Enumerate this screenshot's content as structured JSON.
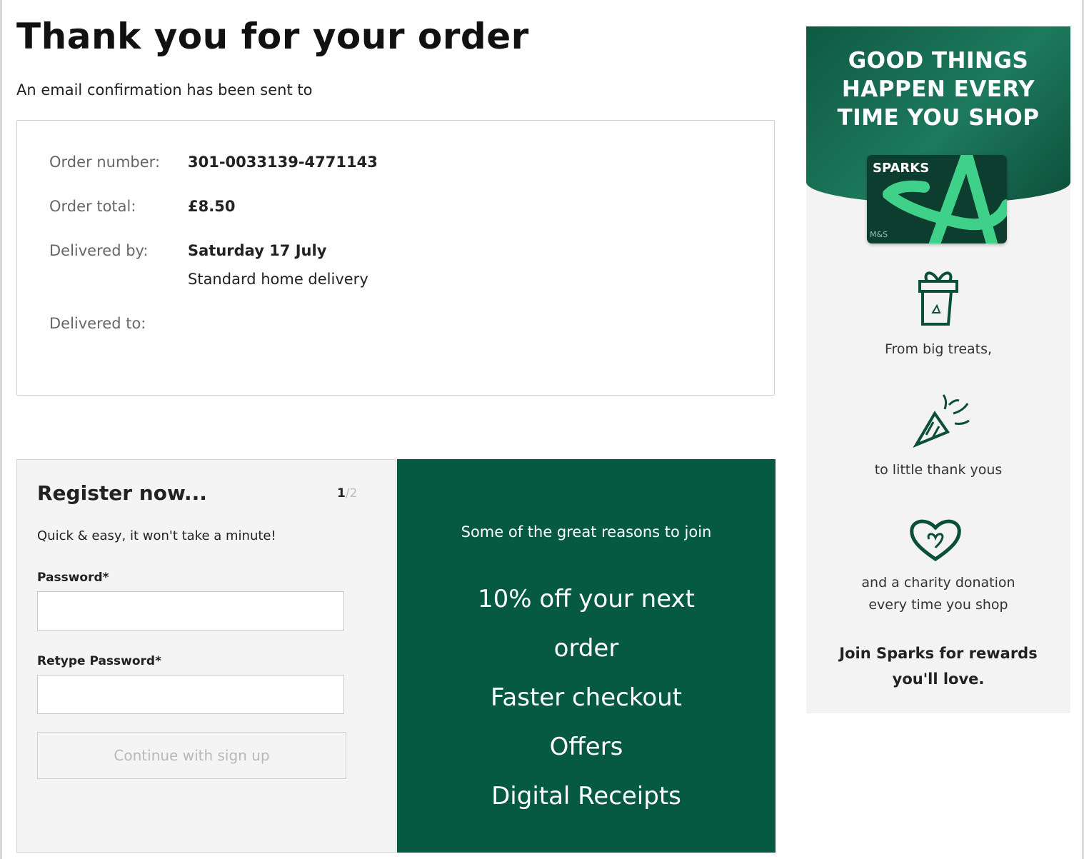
{
  "page": {
    "title": "Thank you for your order",
    "email_confirmation": "An email confirmation has been sent to"
  },
  "order": {
    "number_label": "Order number:",
    "number_value": "301-0033139-4771143",
    "total_label": "Order total:",
    "total_value": "£8.50",
    "delivered_by_label": "Delivered by:",
    "delivered_by_date": "Saturday 17 July",
    "delivered_by_method": "Standard home delivery",
    "delivered_to_label": "Delivered to:"
  },
  "register": {
    "title": "Register now...",
    "step_current": "1",
    "step_total": "/2",
    "subtitle": "Quick & easy, it won't take a minute!",
    "password_label": "Password*",
    "password_value": "",
    "retype_label": "Retype Password*",
    "retype_value": "",
    "continue_label": "Continue with sign up"
  },
  "reasons": {
    "intro": "Some of the great reasons to join",
    "items": [
      "10% off your next",
      "order",
      "Faster checkout",
      "Offers",
      "Digital Receipts"
    ]
  },
  "sparks": {
    "headline": "GOOD THINGS HAPPEN EVERY TIME YOU SHOP",
    "card_brand": "SPARKS",
    "card_small": "M&S",
    "benefit_1": "From big treats,",
    "benefit_2": "to little thank yous",
    "benefit_3_line1": "and a charity donation",
    "benefit_3_line2": "every time you shop",
    "join_line1": "Join Sparks for rewards",
    "join_line2": "you'll love.",
    "icons": [
      "gift-icon",
      "party-popper-icon",
      "heart-icon"
    ]
  },
  "colors": {
    "brand_green": "#055a41",
    "sparks_green": "#1d7a5c",
    "sparks_accent": "#3fd08a",
    "panel_grey": "#f4f4f4"
  }
}
